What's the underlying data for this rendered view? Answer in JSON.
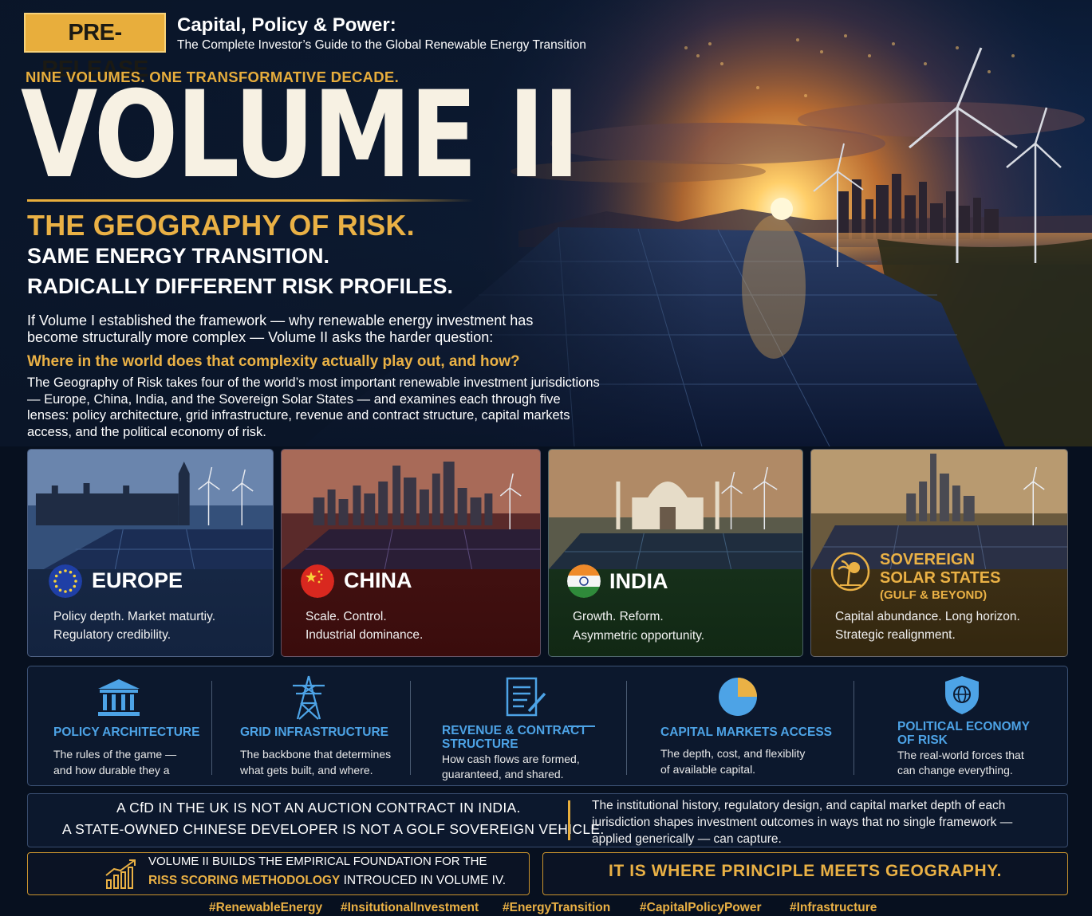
{
  "header": {
    "badge": "PRE-RELEASE",
    "series_title": "Capital, Policy & Power:",
    "series_subtitle": "The Complete Investor’s Guide to the Global Renewable Energy Transition",
    "tagline": "NINE VOLUMES. ONE TRANSFORMATIVE DECADE.",
    "volume": "VOLUME II"
  },
  "headline": {
    "title": "THE GEOGRAPHY OF RISK.",
    "line1": "SAME ENERGY TRANSITION.",
    "line2": "RADICALLY DIFFERENT RISK PROFILES."
  },
  "intro": {
    "text": "If Volume I established the framework — why renewable energy investment has become structurally more complex — Volume II asks the harder question:",
    "question": "Where in the world does that complexity actually play out, and how?",
    "body": "The Geography of Risk takes four of the world’s most important renewable investment jurisdictions — Europe, China, India, and the Sovereign Solar States — and examines each through five lenses: policy architecture, grid infrastructure, revenue and contract structure, capital markets access, and the political economy of risk."
  },
  "regions": [
    {
      "name": "EUROPE",
      "line1": "Policy depth. Market maturtiy.",
      "line2": "Regulatory credibility.",
      "icon": "eu-flag-icon"
    },
    {
      "name": "CHINA",
      "line1": "Scale. Control.",
      "line2": "Industrial dominance.",
      "icon": "china-flag-icon"
    },
    {
      "name": "INDIA",
      "line1": "Growth. Reform.",
      "line2": "Asymmetric opportunity.",
      "icon": "india-flag-icon"
    },
    {
      "name": "SOVEREIGN",
      "name2": "SOLAR STATES",
      "name3": "(GULF & BEYOND)",
      "line1": "Capital abundance. Long horizon.",
      "line2": "Strategic realignment.",
      "icon": "palm-sun-icon"
    }
  ],
  "lenses": [
    {
      "title": "POLICY ARCHITECTURE",
      "desc1": "The rules of the game —",
      "desc2": "and how durable they a",
      "icon": "government-building-icon"
    },
    {
      "title": "GRID INFRASTRUCTURE",
      "desc1": "The backbone that determines",
      "desc2": "what gets built, and where.",
      "icon": "transmission-tower-icon"
    },
    {
      "title": "REVENUE & CONTRACT",
      "title2": "STRUCTURE",
      "desc1": "How cash flows are formed,",
      "desc2": "guaranteed, and shared.",
      "icon": "contract-document-icon"
    },
    {
      "title": "CAPITAL MARKETS ACCESS",
      "desc1": "The depth, cost, and flexiblity",
      "desc2": "of available capital.",
      "icon": "pie-chart-icon"
    },
    {
      "title": "POLITICAL ECONOMY",
      "title2": "OF RISK",
      "desc1": "The real-world forces that",
      "desc2": "can change everything.",
      "icon": "shield-globe-icon"
    }
  ],
  "statements": {
    "cfd_line1": "A CfD IN THE UK IS NOT AN AUCTION CONTRACT IN INDIA.",
    "cfd_line2": "A STATE-OWNED CHINESE DEVELOPER IS NOT A GOLF SOVEREIGN VEHICLE.",
    "institutional": "The institutional history, regulatory design, and capital market depth of each jurisdiction shapes investment outcomes in ways that no single framework — applied generically — can capture.",
    "builds_line1": "VOLUME II BUILDS THE EMPIRICAL FOUNDATION FOR THE",
    "builds_highlight": "RISS SCORING METHODOLOGY",
    "builds_line2_rest": " INTROUCED IN VOLUME IV.",
    "principle": "IT IS WHERE PRINCIPLE MEETS GEOGRAPHY."
  },
  "hashtags": [
    "#RenewableEnergy",
    "#InsitutionalInvestment",
    "#EnergyTransition",
    "#CapitalPolicyPower",
    "#Infrastructure"
  ],
  "colors": {
    "gold": "#eab145",
    "lens_blue": "#4da3e6",
    "navy": "#07101f",
    "europe": "#13233f",
    "china": "#3a0c0c",
    "india": "#112814",
    "sovereign": "#33270f"
  }
}
